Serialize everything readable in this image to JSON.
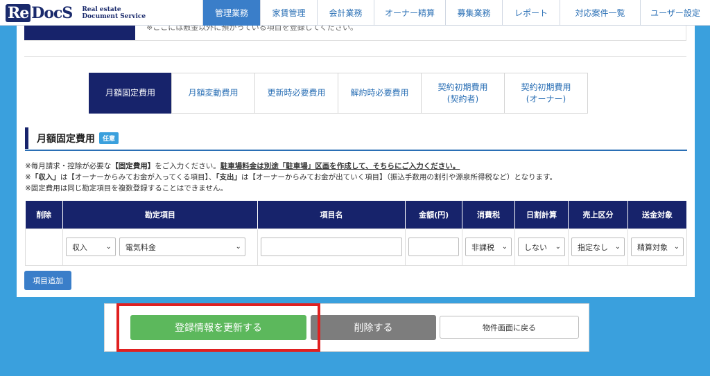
{
  "logo": {
    "mark_re": "Re",
    "mark_rest": "DocS",
    "sub_line1": "Real estate",
    "sub_line2": "Document Service"
  },
  "nav": [
    {
      "label": "管理業務",
      "active": true
    },
    {
      "label": "家賃管理"
    },
    {
      "label": "会計業務"
    },
    {
      "label": "オーナー精算"
    },
    {
      "label": "募集業務"
    },
    {
      "label": "レポート"
    },
    {
      "label": "対応案件一覧"
    },
    {
      "label": "ユーザー設定"
    }
  ],
  "top_note": "※ここには敷金以外に預かっている項目を登録してください。",
  "tabs": [
    {
      "line1": "月額固定費用",
      "line2": "",
      "active": true
    },
    {
      "line1": "月額変動費用",
      "line2": ""
    },
    {
      "line1": "更新時必要費用",
      "line2": ""
    },
    {
      "line1": "解約時必要費用",
      "line2": ""
    },
    {
      "line1": "契約初期費用",
      "line2": "(契約者)"
    },
    {
      "line1": "契約初期費用",
      "line2": "(オーナー)"
    }
  ],
  "section": {
    "title": "月額固定費用",
    "badge": "任意"
  },
  "notes": {
    "line1_a": "※毎月請求・控除が必要な",
    "line1_b": "【固定費用】",
    "line1_c": "をご入力ください。",
    "line1_d": "駐車場料金は別途「駐車場」区画を作成して、そちらにご入力ください。",
    "line2_a": "※",
    "line2_b": "「収入」",
    "line2_c": "は【オーナーからみてお金が入ってくる項目】、",
    "line2_d": "「支出」",
    "line2_e": "は【オーナーからみてお金が出ていく項目】（振込手数用の割引や源泉所得税など）となります。",
    "line3": "※固定費用は同じ勘定項目を複数登録することはできません。"
  },
  "table": {
    "headers": [
      "削除",
      "勘定項目",
      "項目名",
      "金額(円)",
      "消費税",
      "日割計算",
      "売上区分",
      "送金対象"
    ],
    "row": {
      "type": "収入",
      "account": "電気料金",
      "item_name": "",
      "amount": "",
      "tax": "非課税",
      "prorate": "しない",
      "sales": "指定なし",
      "remit": "精算対象"
    }
  },
  "buttons": {
    "add_item": "項目追加",
    "update": "登録情報を更新する",
    "delete": "削除する",
    "back": "物件画面に戻る"
  },
  "colors": {
    "navy": "#17236b",
    "accent": "#3a7ec9",
    "green": "#5cb85c",
    "highlight": "#e02020",
    "bg": "#3aa0dd"
  }
}
